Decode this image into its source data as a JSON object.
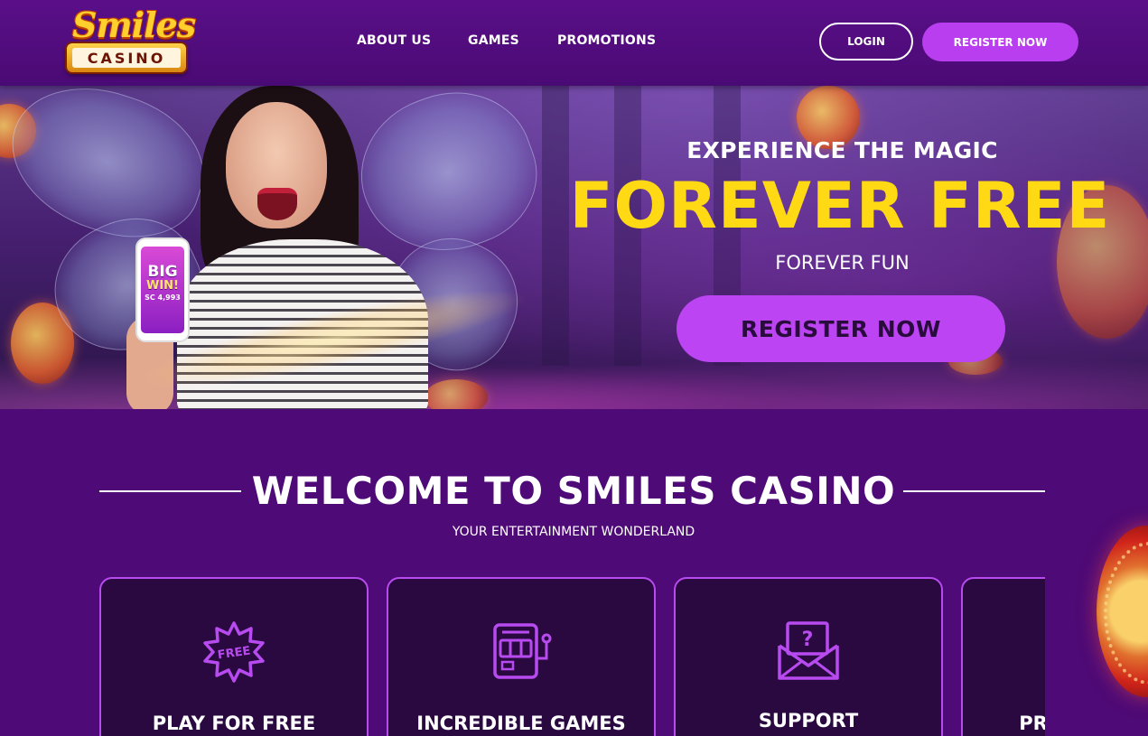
{
  "brand": {
    "logo_script": "Smiles",
    "logo_word": "CASINO"
  },
  "nav": {
    "items": [
      {
        "label": "ABOUT US"
      },
      {
        "label": "GAMES"
      },
      {
        "label": "PROMOTIONS"
      }
    ],
    "login_label": "LOGIN",
    "register_label": "REGISTER NOW"
  },
  "hero": {
    "kicker": "EXPERIENCE THE MAGIC",
    "title": "FOREVER FREE",
    "subtitle": "FOREVER FUN",
    "cta_label": "REGISTER NOW",
    "phone": {
      "line1": "BIG",
      "line2": "WIN!",
      "line3": "SC 4,993"
    }
  },
  "welcome": {
    "title": "WELCOME TO SMILES CASINO",
    "subtitle": "YOUR ENTERTAINMENT WONDERLAND"
  },
  "features": [
    {
      "label": "PLAY FOR FREE",
      "icon": "free-badge-icon",
      "icon_text": "FREE"
    },
    {
      "label": "INCREDIBLE GAMES",
      "icon": "slot-machine-icon"
    },
    {
      "label": "SUPPORT",
      "icon": "question-envelope-icon",
      "icon_text": "?"
    },
    {
      "label": "PR",
      "icon": "unknown-icon"
    }
  ],
  "colors": {
    "page_bg": "#4e0a76",
    "accent_purple": "#bc44f2",
    "title_yellow": "#ffd914",
    "card_border": "#b84bf0"
  }
}
